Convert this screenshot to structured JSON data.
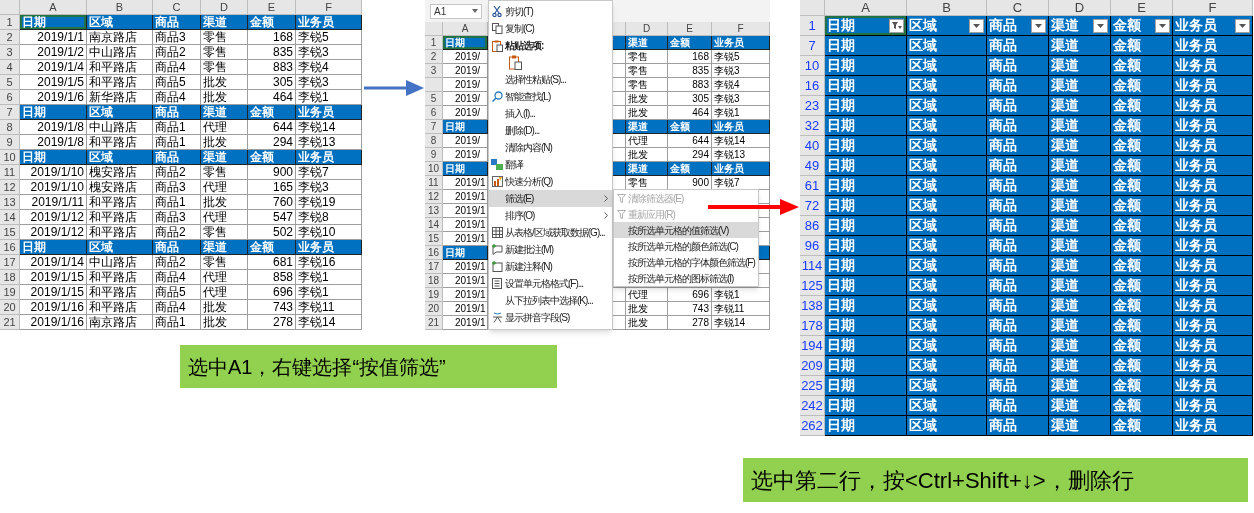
{
  "left_sheet": {
    "a1_selected": true,
    "columns": [
      "A",
      "B",
      "C",
      "D",
      "E",
      "F"
    ],
    "rows": [
      {
        "num": "1",
        "header": true,
        "cells": [
          "日期",
          "区域",
          "商品",
          "渠道",
          "金额",
          "业务员"
        ]
      },
      {
        "num": "2",
        "header": false,
        "cells": [
          "2019/1/1",
          "南京路店",
          "商品3",
          "零售",
          "168",
          "李锐5"
        ]
      },
      {
        "num": "3",
        "header": false,
        "cells": [
          "2019/1/2",
          "中山路店",
          "商品2",
          "零售",
          "835",
          "李锐3"
        ]
      },
      {
        "num": "4",
        "header": false,
        "cells": [
          "2019/1/4",
          "和平路店",
          "商品4",
          "零售",
          "883",
          "李锐4"
        ]
      },
      {
        "num": "5",
        "header": false,
        "cells": [
          "2019/1/5",
          "和平路店",
          "商品5",
          "批发",
          "305",
          "李锐3"
        ]
      },
      {
        "num": "6",
        "header": false,
        "cells": [
          "2019/1/6",
          "新华路店",
          "商品4",
          "批发",
          "464",
          "李锐1"
        ]
      },
      {
        "num": "7",
        "header": true,
        "cells": [
          "日期",
          "区域",
          "商品",
          "渠道",
          "金额",
          "业务员"
        ]
      },
      {
        "num": "8",
        "header": false,
        "cells": [
          "2019/1/8",
          "中山路店",
          "商品1",
          "代理",
          "644",
          "李锐14"
        ]
      },
      {
        "num": "9",
        "header": false,
        "cells": [
          "2019/1/8",
          "和平路店",
          "商品1",
          "批发",
          "294",
          "李锐13"
        ]
      },
      {
        "num": "10",
        "header": true,
        "cells": [
          "日期",
          "区域",
          "商品",
          "渠道",
          "金额",
          "业务员"
        ]
      },
      {
        "num": "11",
        "header": false,
        "cells": [
          "2019/1/10",
          "槐安路店",
          "商品2",
          "零售",
          "900",
          "李锐7"
        ]
      },
      {
        "num": "12",
        "header": false,
        "cells": [
          "2019/1/10",
          "槐安路店",
          "商品3",
          "代理",
          "165",
          "李锐3"
        ]
      },
      {
        "num": "13",
        "header": false,
        "cells": [
          "2019/1/11",
          "和平路店",
          "商品1",
          "批发",
          "760",
          "李锐19"
        ]
      },
      {
        "num": "14",
        "header": false,
        "cells": [
          "2019/1/12",
          "和平路店",
          "商品3",
          "代理",
          "547",
          "李锐8"
        ]
      },
      {
        "num": "15",
        "header": false,
        "cells": [
          "2019/1/12",
          "和平路店",
          "商品2",
          "零售",
          "502",
          "李锐10"
        ]
      },
      {
        "num": "16",
        "header": true,
        "cells": [
          "日期",
          "区域",
          "商品",
          "渠道",
          "金额",
          "业务员"
        ]
      },
      {
        "num": "17",
        "header": false,
        "cells": [
          "2019/1/14",
          "中山路店",
          "商品2",
          "零售",
          "681",
          "李锐16"
        ]
      },
      {
        "num": "18",
        "header": false,
        "cells": [
          "2019/1/15",
          "和平路店",
          "商品4",
          "代理",
          "858",
          "李锐1"
        ]
      },
      {
        "num": "19",
        "header": false,
        "cells": [
          "2019/1/15",
          "和平路店",
          "商品5",
          "代理",
          "696",
          "李锐1"
        ]
      },
      {
        "num": "20",
        "header": false,
        "cells": [
          "2019/1/16",
          "和平路店",
          "商品4",
          "批发",
          "743",
          "李锐11"
        ]
      },
      {
        "num": "21",
        "header": false,
        "cells": [
          "2019/1/16",
          "南京路店",
          "商品1",
          "批发",
          "278",
          "李锐14"
        ]
      }
    ]
  },
  "middle_sheet": {
    "name_box": "A1",
    "a1_selected": true,
    "columns": {
      "a": "A",
      "d": "D",
      "e": "E",
      "f": "F"
    },
    "rows": [
      {
        "num": "1",
        "header": true,
        "a": "日期",
        "d": "渠道",
        "e": "金额",
        "f": "业务员"
      },
      {
        "num": "2",
        "header": false,
        "a": "2019/",
        "d": "零售",
        "e": "168",
        "f": "李锐5"
      },
      {
        "num": "3",
        "header": false,
        "a": "2019/",
        "d": "零售",
        "e": "835",
        "f": "李锐3"
      },
      {
        "header": false,
        "a": "2019/",
        "d": "零售",
        "e": "883",
        "f": "李锐4"
      },
      {
        "num": "5",
        "header": false,
        "a": "2019/",
        "d": "批发",
        "e": "305",
        "f": "李锐3"
      },
      {
        "num": "6",
        "header": false,
        "a": "2019/",
        "d": "批发",
        "e": "464",
        "f": "李锐1"
      },
      {
        "num": "7",
        "header": true,
        "a": "日期",
        "d": "渠道",
        "e": "金额",
        "f": "业务员"
      },
      {
        "num": "8",
        "header": false,
        "a": "2019/",
        "d": "代理",
        "e": "644",
        "f": "李锐14"
      },
      {
        "num": "9",
        "header": false,
        "a": "2019/",
        "d": "批发",
        "e": "294",
        "f": "李锐13"
      },
      {
        "num": "10",
        "header": true,
        "a": "日期",
        "d": "渠道",
        "e": "金额",
        "f": "业务员"
      },
      {
        "num": "11",
        "header": false,
        "a": "2019/1",
        "d": "零售",
        "e": "900",
        "f": "李锐7"
      },
      {
        "num": "12",
        "header": false,
        "a": "2019/1"
      },
      {
        "num": "13",
        "header": false,
        "a": "2019/1"
      },
      {
        "num": "14",
        "header": false,
        "a": "2019/1"
      },
      {
        "num": "15",
        "header": false,
        "a": "2019/1"
      },
      {
        "num": "16",
        "header": true,
        "a": "日期"
      },
      {
        "num": "17",
        "header": false,
        "a": "2019/1"
      },
      {
        "num": "18",
        "header": false,
        "a": "2019/1"
      },
      {
        "num": "19",
        "header": false,
        "a": "2019/1",
        "d": "代理",
        "e": "696",
        "f": "李锐1"
      },
      {
        "num": "20",
        "header": false,
        "a": "2019/1",
        "d": "批发",
        "e": "743",
        "f": "李锐11"
      },
      {
        "num": "21",
        "header": false,
        "a": "2019/1",
        "d": "批发",
        "e": "278",
        "f": "李锐14"
      }
    ]
  },
  "context_menu": {
    "items": [
      {
        "kind": "item",
        "label": "剪切(T)",
        "selected": false
      },
      {
        "kind": "item",
        "label": "复制(C)",
        "selected": false
      },
      {
        "kind": "heading",
        "label": "粘贴选项:"
      },
      {
        "kind": "paste_options"
      },
      {
        "kind": "item",
        "label": "选择性粘贴(S)...",
        "selected": false
      },
      {
        "kind": "item",
        "label": "智能查找(L)",
        "selected": false
      },
      {
        "kind": "item",
        "label": "插入(I)...",
        "selected": false
      },
      {
        "kind": "item",
        "label": "删除(D)...",
        "selected": false
      },
      {
        "kind": "item",
        "label": "清除内容(N)",
        "selected": false
      },
      {
        "kind": "item",
        "label": "翻译",
        "selected": false
      },
      {
        "kind": "item",
        "label": "快速分析(Q)",
        "selected": false
      },
      {
        "kind": "submenu",
        "label": "筛选(E)",
        "selected": true
      },
      {
        "kind": "submenu",
        "label": "排序(O)",
        "selected": false
      },
      {
        "kind": "item",
        "label": "从表格/区域获取数据(G)...",
        "selected": false
      },
      {
        "kind": "item",
        "label": "新建批注(M)",
        "selected": false
      },
      {
        "kind": "item",
        "label": "新建注释(N)",
        "selected": false
      },
      {
        "kind": "item",
        "label": "设置单元格格式(F)...",
        "selected": false
      },
      {
        "kind": "item",
        "label": "从下拉列表中选择(K)...",
        "selected": false
      },
      {
        "kind": "item",
        "label": "显示拼音字段(S)",
        "selected": false
      }
    ]
  },
  "submenu": {
    "items": [
      {
        "label": "清除筛选器(E)",
        "disabled": true,
        "selected": false
      },
      {
        "label": "重新应用(R)",
        "disabled": true,
        "selected": false
      },
      {
        "label": "按所选单元格的值筛选(V)",
        "disabled": false,
        "selected": true
      },
      {
        "label": "按所选单元格的颜色筛选(C)",
        "disabled": false,
        "selected": false
      },
      {
        "label": "按所选单元格的字体颜色筛选(F)",
        "disabled": false,
        "selected": false
      },
      {
        "label": "按所选单元格的图标筛选(I)",
        "disabled": false,
        "selected": false
      }
    ]
  },
  "right_sheet": {
    "a1_selected": true,
    "filtered": true,
    "columns": [
      {
        "letter": "A",
        "filter_applied": true
      },
      {
        "letter": "B",
        "filter_applied": false
      },
      {
        "letter": "C",
        "filter_applied": false
      },
      {
        "letter": "D",
        "filter_applied": false
      },
      {
        "letter": "E",
        "filter_applied": false
      },
      {
        "letter": "F",
        "filter_applied": false
      }
    ],
    "rows": [
      {
        "num": "1",
        "header": true,
        "cells": [
          "日期",
          "区域",
          "商品",
          "渠道",
          "金额",
          "业务员"
        ]
      },
      {
        "num": "7",
        "header": true,
        "cells": [
          "日期",
          "区域",
          "商品",
          "渠道",
          "金额",
          "业务员"
        ]
      },
      {
        "num": "10",
        "header": true,
        "cells": [
          "日期",
          "区域",
          "商品",
          "渠道",
          "金额",
          "业务员"
        ]
      },
      {
        "num": "16",
        "header": true,
        "cells": [
          "日期",
          "区域",
          "商品",
          "渠道",
          "金额",
          "业务员"
        ]
      },
      {
        "num": "23",
        "header": true,
        "cells": [
          "日期",
          "区域",
          "商品",
          "渠道",
          "金额",
          "业务员"
        ]
      },
      {
        "num": "32",
        "header": true,
        "cells": [
          "日期",
          "区域",
          "商品",
          "渠道",
          "金额",
          "业务员"
        ]
      },
      {
        "num": "40",
        "header": true,
        "cells": [
          "日期",
          "区域",
          "商品",
          "渠道",
          "金额",
          "业务员"
        ]
      },
      {
        "num": "49",
        "header": true,
        "cells": [
          "日期",
          "区域",
          "商品",
          "渠道",
          "金额",
          "业务员"
        ]
      },
      {
        "num": "61",
        "header": true,
        "cells": [
          "日期",
          "区域",
          "商品",
          "渠道",
          "金额",
          "业务员"
        ]
      },
      {
        "num": "72",
        "header": true,
        "cells": [
          "日期",
          "区域",
          "商品",
          "渠道",
          "金额",
          "业务员"
        ]
      },
      {
        "num": "86",
        "header": true,
        "cells": [
          "日期",
          "区域",
          "商品",
          "渠道",
          "金额",
          "业务员"
        ]
      },
      {
        "num": "96",
        "header": true,
        "cells": [
          "日期",
          "区域",
          "商品",
          "渠道",
          "金额",
          "业务员"
        ]
      },
      {
        "num": "114",
        "header": true,
        "cells": [
          "日期",
          "区域",
          "商品",
          "渠道",
          "金额",
          "业务员"
        ]
      },
      {
        "num": "125",
        "header": true,
        "cells": [
          "日期",
          "区域",
          "商品",
          "渠道",
          "金额",
          "业务员"
        ]
      },
      {
        "num": "138",
        "header": true,
        "cells": [
          "日期",
          "区域",
          "商品",
          "渠道",
          "金额",
          "业务员"
        ]
      },
      {
        "num": "178",
        "header": true,
        "cells": [
          "日期",
          "区域",
          "商品",
          "渠道",
          "金额",
          "业务员"
        ]
      },
      {
        "num": "194",
        "header": true,
        "cells": [
          "日期",
          "区域",
          "商品",
          "渠道",
          "金额",
          "业务员"
        ]
      },
      {
        "num": "209",
        "header": true,
        "cells": [
          "日期",
          "区域",
          "商品",
          "渠道",
          "金额",
          "业务员"
        ]
      },
      {
        "num": "225",
        "header": true,
        "cells": [
          "日期",
          "区域",
          "商品",
          "渠道",
          "金额",
          "业务员"
        ]
      },
      {
        "num": "242",
        "header": true,
        "cells": [
          "日期",
          "区域",
          "商品",
          "渠道",
          "金额",
          "业务员"
        ]
      },
      {
        "num": "262",
        "header": true,
        "cells": [
          "日期",
          "区域",
          "商品",
          "渠道",
          "金额",
          "业务员"
        ]
      }
    ]
  },
  "captions": [
    {
      "text": "选中A1，右键选择“按值筛选”"
    },
    {
      "text": "选中第二行，按<Ctrl+Shift+↓>，删除行"
    }
  ]
}
